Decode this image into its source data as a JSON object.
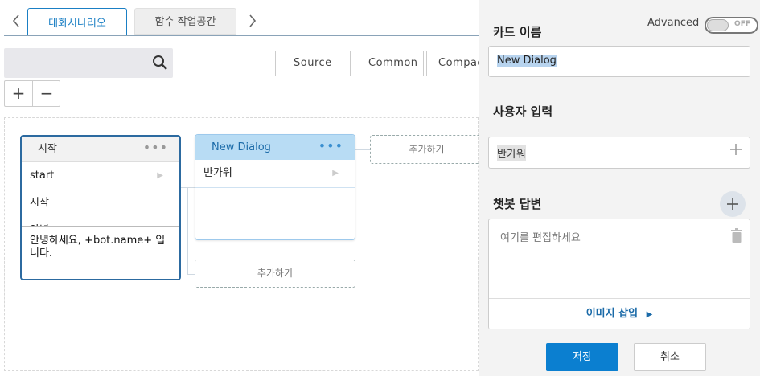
{
  "tabs": [
    {
      "label": "대화시나리오",
      "active": true
    },
    {
      "label": "함수 작업공간",
      "active": false
    }
  ],
  "toolbar": {
    "search_value": "",
    "view_buttons": [
      "Source",
      "Common",
      "Compac"
    ]
  },
  "zoom": {
    "in_label": "+",
    "out_label": "−"
  },
  "cards": {
    "start": {
      "title": "시작",
      "rows": [
        "start",
        "시작",
        "안녕"
      ],
      "response": "안녕하세요, +bot.name+ 입니다."
    },
    "new_dialog": {
      "title": "New Dialog",
      "rows": [
        "반가워"
      ]
    },
    "add_label": "추가하기"
  },
  "panel": {
    "card_name_label": "카드 이름",
    "advanced_label": "Advanced",
    "advanced_toggle": "OFF",
    "card_name_value": "New Dialog",
    "user_input_label": "사용자 입력",
    "user_input_value": "반가워",
    "bot_answer_label": "챗봇 답변",
    "bot_answer_placeholder": "여기를 편집하세요",
    "insert_image_label": "이미지 삽입",
    "save_label": "저장",
    "cancel_label": "취소"
  },
  "colors": {
    "accent": "#1a7fc4",
    "save_button": "#0b7fd0",
    "card_header_active": "#b8dcf4"
  }
}
